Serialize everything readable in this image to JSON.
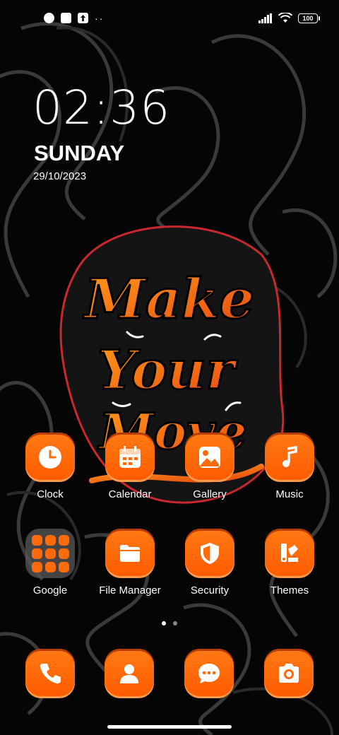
{
  "status_bar": {
    "left_icons": [
      "app-notification-icon",
      "square-notification-icon",
      "upload-notification-icon"
    ],
    "more": "··",
    "battery": "100"
  },
  "clock_widget": {
    "time": "02:36",
    "day": "SUNDAY",
    "date": "29/10/2023"
  },
  "wallpaper": {
    "text": "Make Your Move",
    "accent": "#ff6a0a"
  },
  "apps": [
    {
      "label": "Clock",
      "icon": "clock-icon"
    },
    {
      "label": "Calendar",
      "icon": "calendar-icon"
    },
    {
      "label": "Gallery",
      "icon": "image-icon"
    },
    {
      "label": "Music",
      "icon": "music-note-icon"
    },
    {
      "label": "Google",
      "icon": "folder-icon"
    },
    {
      "label": "File Manager",
      "icon": "folder-icon"
    },
    {
      "label": "Security",
      "icon": "shield-icon"
    },
    {
      "label": "Themes",
      "icon": "themes-icon"
    }
  ],
  "page_indicator": {
    "pages": 2,
    "current": 1
  },
  "dock": [
    {
      "icon": "phone-icon"
    },
    {
      "icon": "contacts-icon"
    },
    {
      "icon": "messages-icon"
    },
    {
      "icon": "camera-icon"
    }
  ],
  "colors": {
    "icon_orange": "#ff6a0a",
    "background": "#050505",
    "text": "#ffffff"
  }
}
